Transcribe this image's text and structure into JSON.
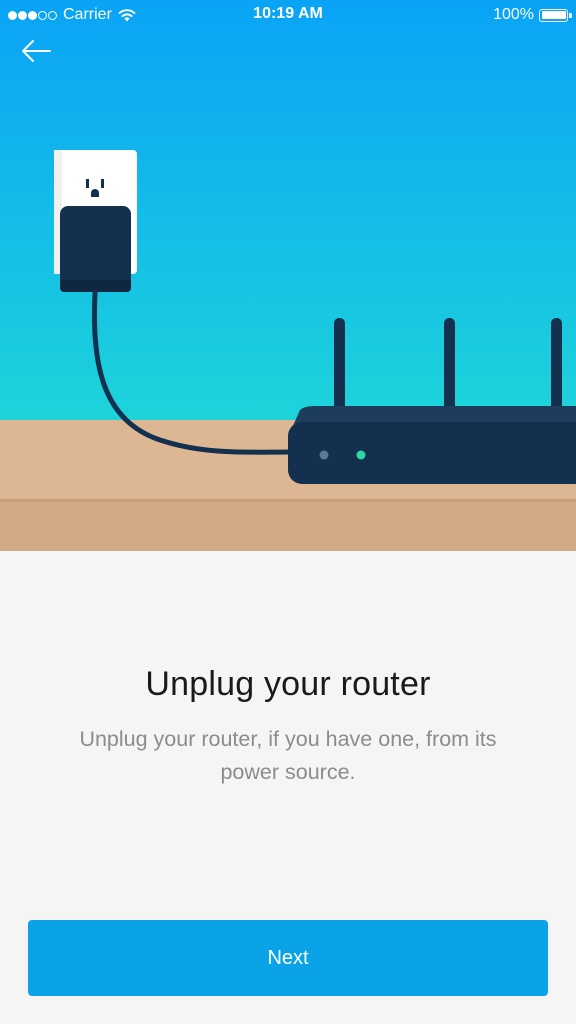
{
  "status_bar": {
    "signal_filled": 3,
    "signal_total": 5,
    "carrier": "Carrier",
    "time": "10:19 AM",
    "battery_percent": "100%",
    "battery_level": 1.0
  },
  "navigation": {
    "back_icon": "arrow-left-icon"
  },
  "illustration": {
    "subject": "router-unplug-illustration",
    "sky_color_top": "#0aa7f4",
    "sky_color_bottom": "#1ad4dc",
    "table_color": "#deb896",
    "router_color": "#14304f",
    "router_led_colors": [
      "#5f7890",
      "#2bd8a3"
    ]
  },
  "content": {
    "title": "Unplug your router",
    "description": "Unplug your router, if you have one, from its power source."
  },
  "actions": {
    "next_label": "Next",
    "accent_color": "#0ba3e8"
  }
}
